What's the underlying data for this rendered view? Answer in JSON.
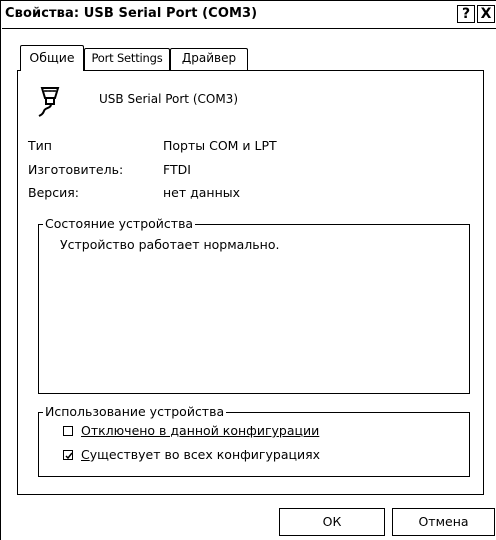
{
  "window": {
    "title": "Свойства: USB Serial Port (COM3)",
    "help_label": "?",
    "close_label": "X"
  },
  "tabs": [
    {
      "label": "Общие",
      "active": true
    },
    {
      "label": "Port Settings",
      "active": false
    },
    {
      "label": "Драйвер",
      "active": false
    }
  ],
  "device": {
    "icon": "serial-port-icon",
    "name": "USB Serial Port (COM3)"
  },
  "properties": [
    {
      "label": "Тип",
      "value": "Порты COM и LPT"
    },
    {
      "label": "Изготовитель:",
      "value": "FTDI"
    },
    {
      "label": "Версия:",
      "value": "нет данных"
    }
  ],
  "status_group": {
    "caption": "Состояние устройства",
    "text": "Устройство работает нормально."
  },
  "usage_group": {
    "caption": "Использование устройства",
    "options": [
      {
        "label": "Отключено в данной конфигурации",
        "checked": false
      },
      {
        "label_first": "С",
        "label_rest": "уществует во всех конфигурациях",
        "checked": true
      }
    ]
  },
  "buttons": {
    "ok": "ОК",
    "cancel": "Отмена"
  }
}
